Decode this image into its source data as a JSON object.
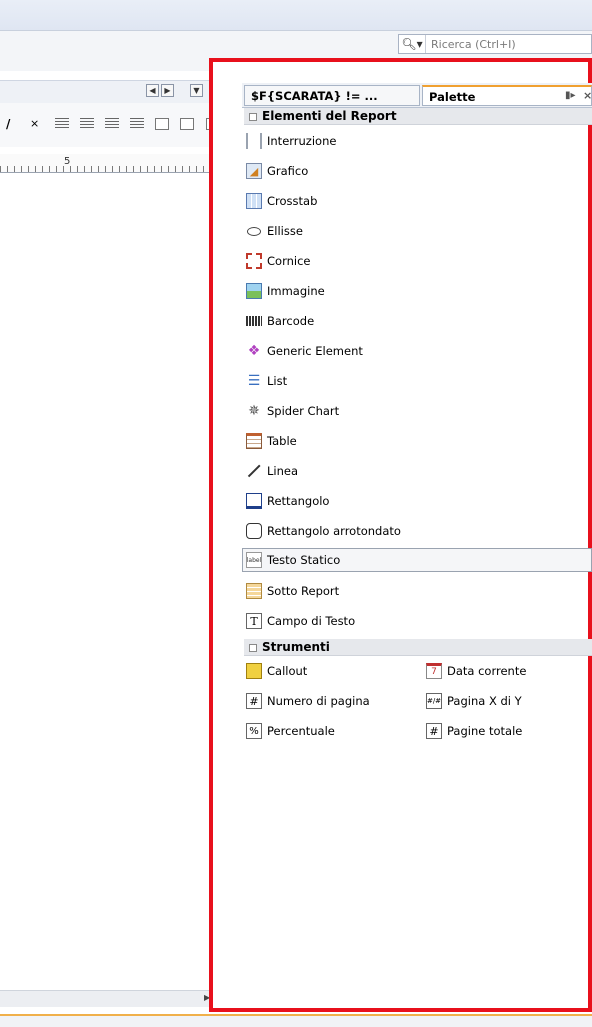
{
  "search": {
    "placeholder": "Ricerca (Ctrl+I)"
  },
  "editor": {
    "ruler_label": "5"
  },
  "panel_tabs": [
    {
      "label": "$F{SCARATA} != ..."
    },
    {
      "label": "Palette"
    }
  ],
  "palette": {
    "section_report": "Elementi del Report",
    "report_items": [
      {
        "label": "Interruzione",
        "icon": "page-break-icon"
      },
      {
        "label": "Grafico",
        "icon": "chart-icon"
      },
      {
        "label": "Crosstab",
        "icon": "crosstab-icon"
      },
      {
        "label": "Ellisse",
        "icon": "ellipse-icon"
      },
      {
        "label": "Cornice",
        "icon": "frame-icon"
      },
      {
        "label": "Immagine",
        "icon": "image-icon"
      },
      {
        "label": "Barcode",
        "icon": "barcode-icon"
      },
      {
        "label": "Generic Element",
        "icon": "generic-element-icon"
      },
      {
        "label": "List",
        "icon": "list-icon"
      },
      {
        "label": "Spider Chart",
        "icon": "spider-chart-icon"
      },
      {
        "label": "Table",
        "icon": "table-icon"
      },
      {
        "label": "Linea",
        "icon": "line-icon"
      },
      {
        "label": "Rettangolo",
        "icon": "rectangle-icon"
      },
      {
        "label": "Rettangolo arrotondato",
        "icon": "rounded-rectangle-icon"
      },
      {
        "label": "Testo Statico",
        "icon": "static-text-icon",
        "icon_text": "label"
      },
      {
        "label": "Sotto Report",
        "icon": "subreport-icon"
      },
      {
        "label": "Campo di Testo",
        "icon": "text-field-icon",
        "icon_text": "T"
      }
    ],
    "section_tools": "Strumenti",
    "tools_left": [
      {
        "label": "Callout",
        "icon": "callout-icon"
      },
      {
        "label": "Numero di pagina",
        "icon": "page-number-icon",
        "icon_text": "#"
      },
      {
        "label": "Percentuale",
        "icon": "percentage-icon",
        "icon_text": "%"
      }
    ],
    "tools_right": [
      {
        "label": "Data corrente",
        "icon": "current-date-icon",
        "icon_text": "7"
      },
      {
        "label": "Pagina X di Y",
        "icon": "page-x-of-y-icon",
        "icon_text": "#/#"
      },
      {
        "label": "Pagine totale",
        "icon": "total-pages-icon",
        "icon_text": "#"
      }
    ]
  },
  "colors": {
    "highlight_border": "#e8101c",
    "tab_accent": "#f0a030"
  }
}
